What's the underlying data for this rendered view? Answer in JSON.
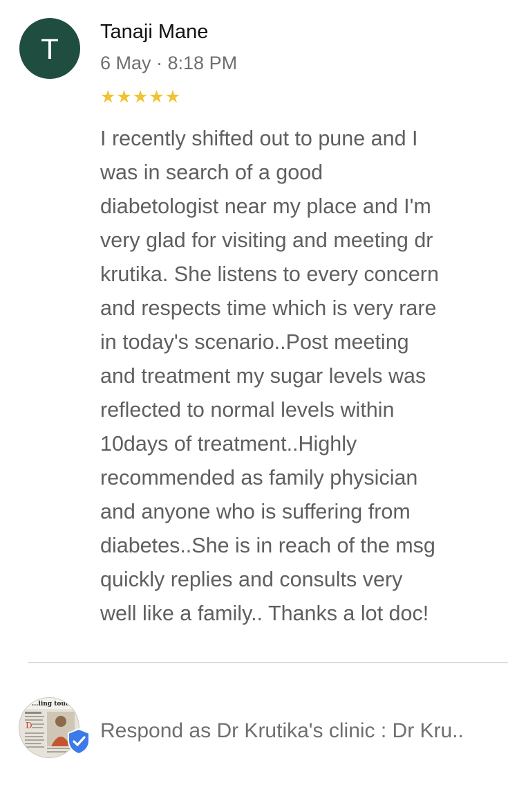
{
  "review": {
    "avatar_letter": "T",
    "avatar_color": "#1f4d3f",
    "reviewer_name": "Tanaji Mane",
    "timestamp": "6 May · 8:18 PM",
    "rating": 5,
    "rating_max": 5,
    "star_color": "#f2c230",
    "text": "I recently shifted out to pune and I\nwas in search of a good\ndiabetologist near my place and I'm\nvery glad for visiting and meeting dr\nkrutika. She listens to every concern\nand respects time which is very rare\nin today's scenario..Post meeting\nand treatment my sugar levels was\nreflected to normal levels within\n10days of treatment..Highly\nrecommended as family physician\nand anyone who is suffering from\ndiabetes..She is in reach of the msg\nquickly replies and consults very\nwell like a family.. Thanks  a lot doc!"
  },
  "reply": {
    "owner_avatar_icon": "clinic-newspaper-thumbnail",
    "owner_avatar_caption": "...ling touch",
    "verified_icon": "verified-shield-icon",
    "verified_color": "#3b7ae8",
    "respond_label": "Respond as Dr Krutika's clinic : Dr Kru.."
  }
}
